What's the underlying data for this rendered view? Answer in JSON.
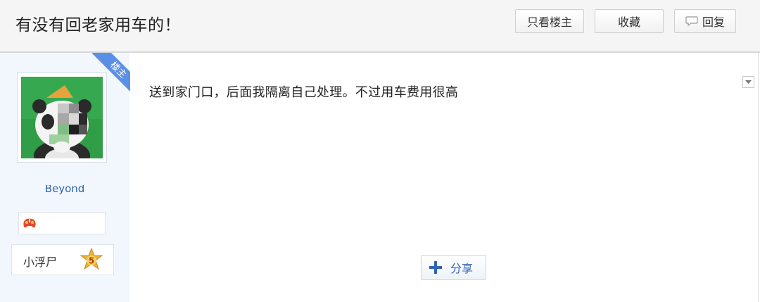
{
  "thread": {
    "title": "有没有回老家用车的！"
  },
  "toolbar": {
    "only_op_label": "只看楼主",
    "favorite_label": "收藏",
    "reply_label": "回复"
  },
  "author": {
    "op_ribbon": "楼主",
    "username": "Beyond",
    "level_name": "小浮尸",
    "level_number": "5"
  },
  "post": {
    "content": "送到家门口，后面我隔离自己处理。不过用车费用很高",
    "share_label": "分享"
  },
  "icons": {
    "reply": "speech-bubble-icon",
    "share": "plus-share-icon",
    "badge": "game-controller-icon",
    "level": "star-badge-icon",
    "menu": "chevron-down-icon"
  },
  "colors": {
    "link_blue": "#2d64b3",
    "ribbon_blue": "#5a8fe6",
    "sidebar_bg": "#f2f7fd",
    "level_star": "#e8b23c"
  }
}
